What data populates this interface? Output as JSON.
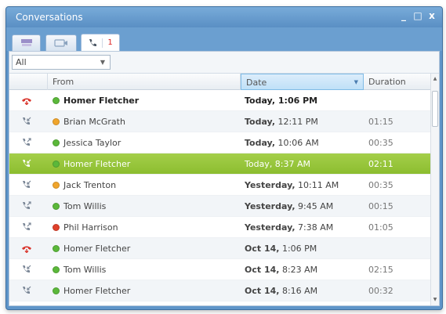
{
  "window": {
    "title": "Conversations",
    "minimize": "_",
    "maximize": "□",
    "close": "x"
  },
  "tabs": [
    {
      "icon": "chat-icon"
    },
    {
      "icon": "video-icon"
    },
    {
      "icon": "phone-icon",
      "badge": "1"
    }
  ],
  "filter": {
    "value": "All"
  },
  "columns": {
    "from": "From",
    "date": "Date",
    "duration": "Duration"
  },
  "rows": [
    {
      "type": "missed",
      "presence": "#5bb83a",
      "from": "Homer Fletcher",
      "date_day": "Today,",
      "date_time": " 1:06 PM",
      "duration": "",
      "unread": true
    },
    {
      "type": "incoming",
      "presence": "#f0a52c",
      "from": "Brian McGrath",
      "date_day": "Today,",
      "date_time": " 12:11 PM",
      "duration": "01:15"
    },
    {
      "type": "outgoing",
      "presence": "#5bb83a",
      "from": "Jessica Taylor",
      "date_day": "Today,",
      "date_time": " 10:06 AM",
      "duration": "00:35"
    },
    {
      "type": "incoming",
      "presence": "#5bb83a",
      "from": "Homer Fletcher",
      "date_day": "Today,",
      "date_time": " 8:37 AM",
      "duration": "02:11",
      "selected": true
    },
    {
      "type": "incoming",
      "presence": "#f0a52c",
      "from": "Jack Trenton",
      "date_day": "Yesterday,",
      "date_time": " 10:11 AM",
      "duration": "00:35"
    },
    {
      "type": "outgoing",
      "presence": "#5bb83a",
      "from": "Tom Willis",
      "date_day": "Yesterday,",
      "date_time": " 9:45 AM",
      "duration": "00:15"
    },
    {
      "type": "outgoing",
      "presence": "#e0412b",
      "from": "Phil Harrison",
      "date_day": "Yesterday,",
      "date_time": " 7:38 AM",
      "duration": "01:05"
    },
    {
      "type": "missed",
      "presence": "#5bb83a",
      "from": "Homer Fletcher",
      "date_day": "Oct 14,",
      "date_time": " 1:06 PM",
      "duration": ""
    },
    {
      "type": "incoming",
      "presence": "#5bb83a",
      "from": "Tom Willis",
      "date_day": "Oct 14,",
      "date_time": " 8:23 AM",
      "duration": "02:15"
    },
    {
      "type": "incoming",
      "presence": "#5bb83a",
      "from": "Homer Fletcher",
      "date_day": "Oct 14,",
      "date_time": " 8:16 AM",
      "duration": "00:32"
    }
  ],
  "colors": {
    "missed": "#d9342b",
    "call": "#7a8696",
    "selected": "#9ccb3f"
  }
}
